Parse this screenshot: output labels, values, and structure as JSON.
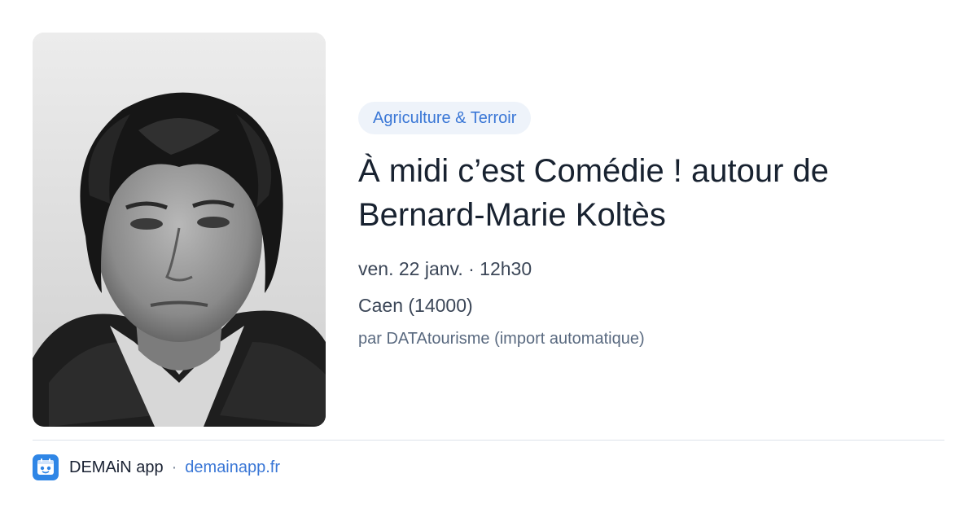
{
  "event": {
    "category": "Agriculture & Terroir",
    "title_line1": "À midi c’est Comédie ! autour de",
    "title_line2": "Bernard-Marie Koltès",
    "date": "ven. 22 janv.",
    "time": "12h30",
    "datetime_separator": "·",
    "location": "Caen (14000)",
    "source": "par DATAtourisme (import automatique)"
  },
  "footer": {
    "app_name": "DEMAiN app",
    "separator": "·",
    "site": "demainapp.fr"
  },
  "colors": {
    "accent": "#3a77d6",
    "tag_background": "#eef3fa",
    "logo_background": "#2f86e6",
    "title": "#182230",
    "meta": "#3b4657",
    "muted": "#5a6a80",
    "divider": "#dde3ea"
  },
  "icons": {
    "app_logo": "demain-logo-icon"
  }
}
